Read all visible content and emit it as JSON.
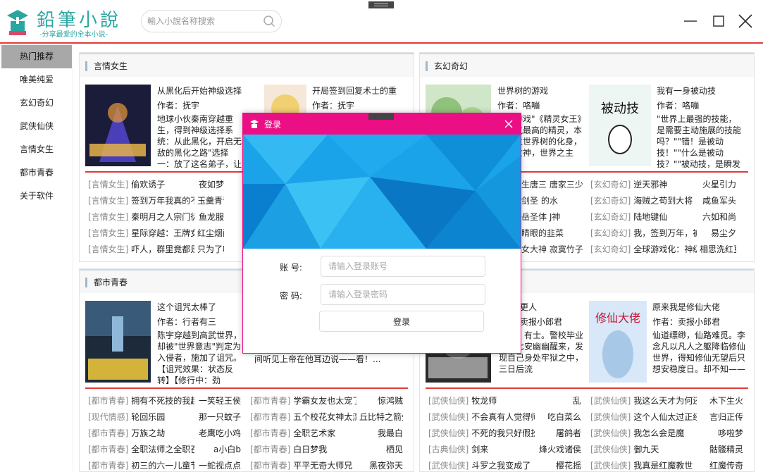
{
  "app": {
    "logo_title": "鉛筆小說",
    "logo_subtitle": "-分享最爱的全本小说-"
  },
  "search": {
    "placeholder": "輸入小說名称搜索"
  },
  "colors": {
    "accent_red": "#e23b3b",
    "modal_pink": "#ec0e85",
    "teal": "#2aa6a0"
  },
  "sidebar": {
    "items": [
      {
        "label": "热门推荐",
        "active": true
      },
      {
        "label": "唯美纯爱"
      },
      {
        "label": "玄幻奇幻"
      },
      {
        "label": "武侠仙侠"
      },
      {
        "label": "言情女生"
      },
      {
        "label": "都市青春"
      },
      {
        "label": "关于软件"
      }
    ]
  },
  "sections": [
    {
      "title": "言情女生",
      "books": [
        {
          "title": "从黑化后开始神级选择",
          "author": "作者：抚宇",
          "desc": "地球小伙秦南穿越重生，得到神级选择系统：从此黑化，开启无敌的黑化之路\"选择一：放了这名弟子，让"
        },
        {
          "title": "开局签到回复术士的重启人生",
          "author": "作者：抚宇",
          "desc": ""
        }
      ],
      "list": [
        {
          "cat": "[言情女生]",
          "title": "偷欢诱子",
          "author": "夜如梦"
        },
        {
          "cat": "[言情女生]",
          "title": "签到万年我真的不想",
          "author": "玉羹青青"
        },
        {
          "cat": "[言情女生]",
          "title": "秦明月之人宗门徒",
          "author": "鱼龙服"
        },
        {
          "cat": "[言情女生]",
          "title": "星际穿越：王牌女元帅",
          "author": "红尘烟雨"
        },
        {
          "cat": "[言情女生]",
          "title": "吓人，群里竟都是高手",
          "author": "只为了哈"
        }
      ]
    },
    {
      "title": "玄幻奇幻",
      "books": [
        {
          "title": "世界树的游戏",
          "author": "作者：咯嘣",
          "desc": "现实游戏\"《精灵女王》中人气最高的精灵，本母，生世界树的化身，生命女神，世界之主——"
        },
        {
          "title": "我有一身被动技",
          "author": "作者：咯嘣",
          "desc": "\"世界上最强的技能，是需要主动施展的技能吗？\"\"错！是被动技！\"\"什么是被动技？\"\"被动技，是瞬发的"
        }
      ],
      "list": [
        {
          "cat": "[玄幻奇幻]",
          "title": "逆天邪神",
          "author": "火星引力"
        },
        {
          "cat": "[玄幻奇幻]",
          "title": "海贼之苟到大将",
          "author": "咸鱼军头"
        },
        {
          "cat": "[玄幻奇幻]",
          "title": "陆地键仙",
          "author": "六如和尚"
        },
        {
          "cat": "[玄幻奇幻]",
          "title": "我，签到万年，被美女",
          "author": "易尘夕"
        },
        {
          "cat": "[玄幻奇幻]",
          "title": "全球游戏化：神级",
          "author": "相思洗红豆"
        }
      ],
      "list_left": [
        {
          "title": "生唐三",
          "author": "唐家三少"
        },
        {
          "title": "剑圣",
          "author": "的水"
        },
        {
          "title": "岳圣体",
          "author": "J神"
        },
        {
          "title": "睛眼的韭菜",
          "author": ""
        },
        {
          "title": "女大神",
          "author": "寂寞竹子"
        }
      ]
    },
    {
      "title": "都市青春",
      "books": [
        {
          "title": "这个诅咒太棒了",
          "author": "作者：行者有三",
          "desc": "陈宇穿越到高武世界，却被\"世界意志\"判定为入侵者，施加了诅咒。【诅咒效果：状态反转】【修行中：劲"
        },
        {
          "title": "",
          "author": "",
          "desc": "熙宸，悄真被拐人他的开重。他在那个瞬间听见上帝在他耳边说——看！..."
        }
      ],
      "list": [
        {
          "cat": "[都市青春]",
          "title": "拥有不死技的我超",
          "author": "一笑轻王侯"
        },
        {
          "cat": "[现代情感]",
          "title": "轮回乐园",
          "author": "那一只蚊子"
        },
        {
          "cat": "[都市青春]",
          "title": "万族之劫",
          "author": "老鹰吃小鸡"
        },
        {
          "cat": "[都市青春]",
          "title": "全职法师之全职召唤",
          "author": "a小白b"
        },
        {
          "cat": "[都市青春]",
          "title": "初三的六一儿童节",
          "author": "一蛇视点点"
        }
      ],
      "list2": [
        {
          "cat": "[都市青春]",
          "title": "学霸女友也太宠了吧",
          "author": "惊鸿贼"
        },
        {
          "cat": "[都市青春]",
          "title": "五个校花女神太漂",
          "author": "丘比特之箭矢"
        },
        {
          "cat": "[都市青春]",
          "title": "全职艺术家",
          "author": "我最白"
        },
        {
          "cat": "[都市青春]",
          "title": "白日梦我",
          "author": "栖见"
        },
        {
          "cat": "[都市青春]",
          "title": "平平无奇大师兄",
          "author": "黑夜弥天"
        }
      ]
    },
    {
      "title": "武侠仙侠",
      "books": [
        {
          "title": "更人",
          "author": "卖报小郎君",
          "desc": "有儒；有士。警校毕业的许七安幽幽醒来，发现自己身处牢狱之中，三日后流"
        },
        {
          "title": "原来我是修仙大佬",
          "author": "作者：卖报小郎君",
          "desc": "仙道缥缈，仙路难觅。李念凡以凡人之躯降临修仙世界，得知修仙无望后只想安稳度日。却不知——"
        }
      ],
      "list": [
        {
          "cat": "[武侠仙侠]",
          "title": "牧龙师",
          "author": "乱"
        },
        {
          "cat": "[武侠仙侠]",
          "title": "不会真有人觉得师",
          "author": "吃白菜么"
        },
        {
          "cat": "[武侠仙侠]",
          "title": "不死的我只好假扮",
          "author": "屠鸽者"
        },
        {
          "cat": "[古典仙侠]",
          "title": "剑来",
          "author": "烽火戏诸侯"
        },
        {
          "cat": "[武侠仙侠]",
          "title": "斗罗之我变成了",
          "author": "樱花摇"
        }
      ],
      "list2": [
        {
          "cat": "[武侠仙侠]",
          "title": "我这么天才为何还",
          "author": "木下生火"
        },
        {
          "cat": "[武侠仙侠]",
          "title": "这个人仙太过正经",
          "author": "言归正传"
        },
        {
          "cat": "[武侠仙侠]",
          "title": "我怎么会是魔",
          "author": "哆啦梦"
        },
        {
          "cat": "[武侠仙侠]",
          "title": "御九天",
          "author": "骷髅精灵"
        },
        {
          "cat": "[武侠仙侠]",
          "title": "我真是红魔教世",
          "author": "红魔传奇"
        }
      ]
    }
  ],
  "login": {
    "title": "登录",
    "account_label": "账  号:",
    "account_placeholder": "请输入登录账号",
    "password_label": "密  码:",
    "password_placeholder": "请输入登录密码",
    "submit": "登录"
  }
}
